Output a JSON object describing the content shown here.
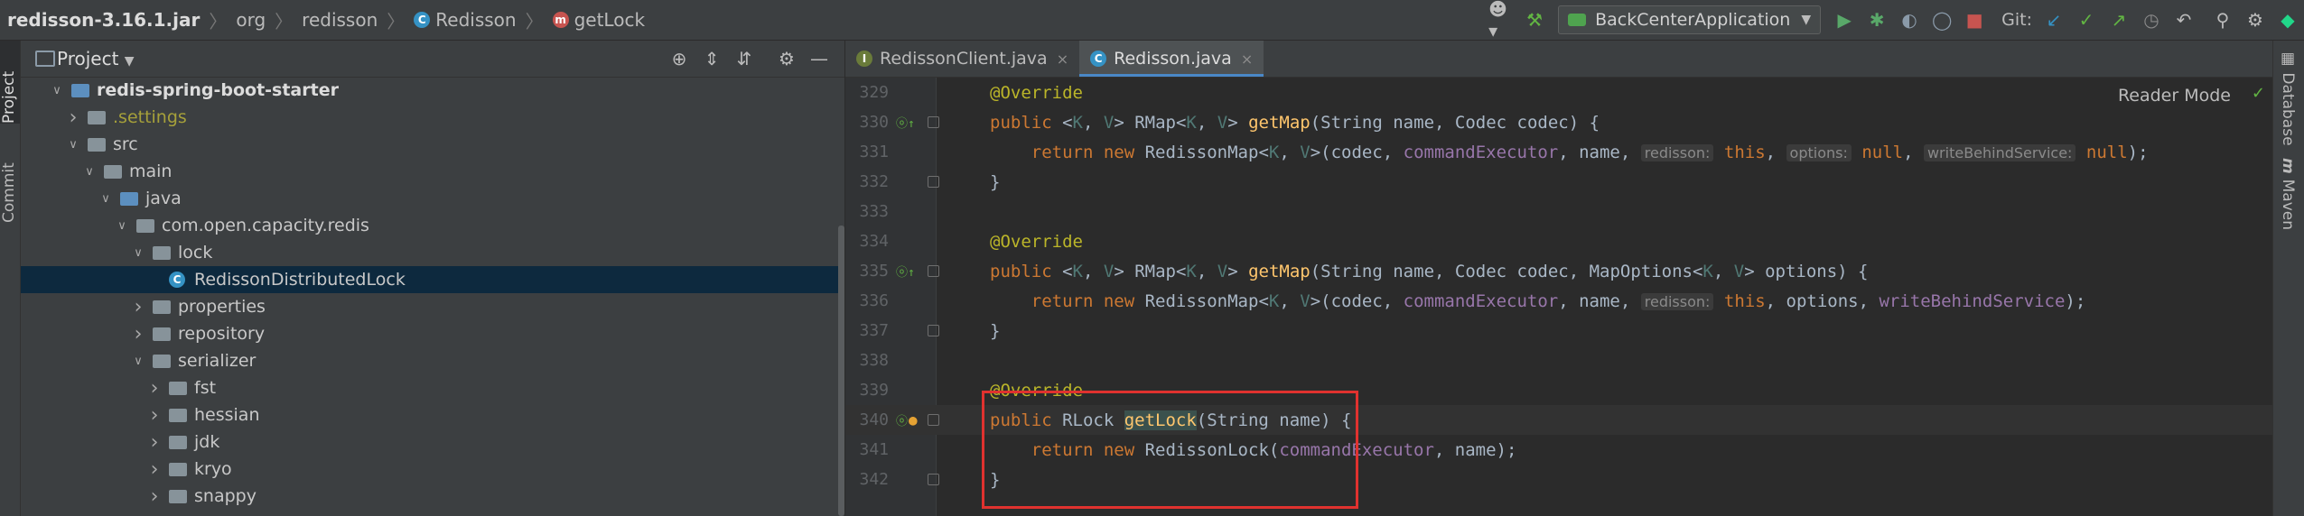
{
  "breadcrumb": {
    "items": [
      {
        "label": "redisson-3.16.1.jar",
        "bold": true
      },
      {
        "label": "org"
      },
      {
        "label": "redisson"
      },
      {
        "label": "Redisson",
        "icon": "class-icon"
      },
      {
        "label": "getLock",
        "icon": "method-icon"
      }
    ]
  },
  "toolbar": {
    "run_config": "BackCenterApplication",
    "git_label": "Git:"
  },
  "left_strip": {
    "project": "Project",
    "commit": "Commit"
  },
  "right_strip": {
    "database": "Database",
    "maven": "Maven"
  },
  "project_panel": {
    "title": "Project",
    "tree": [
      {
        "label": "redis-spring-boot-starter",
        "depth": 2,
        "arrow": "down",
        "icon": "module-folder",
        "bold": true
      },
      {
        "label": ".settings",
        "depth": 3,
        "arrow": "right",
        "icon": "folder",
        "muted": true
      },
      {
        "label": "src",
        "depth": 3,
        "arrow": "down",
        "icon": "folder"
      },
      {
        "label": "main",
        "depth": 4,
        "arrow": "down",
        "icon": "folder"
      },
      {
        "label": "java",
        "depth": 5,
        "arrow": "down",
        "icon": "source-folder"
      },
      {
        "label": "com.open.capacity.redis",
        "depth": 6,
        "arrow": "down",
        "icon": "package"
      },
      {
        "label": "lock",
        "depth": 7,
        "arrow": "down",
        "icon": "package"
      },
      {
        "label": "RedissonDistributedLock",
        "depth": 8,
        "arrow": "",
        "icon": "class",
        "selected": true
      },
      {
        "label": "properties",
        "depth": 7,
        "arrow": "right",
        "icon": "package"
      },
      {
        "label": "repository",
        "depth": 7,
        "arrow": "right",
        "icon": "package"
      },
      {
        "label": "serializer",
        "depth": 7,
        "arrow": "down",
        "icon": "package"
      },
      {
        "label": "fst",
        "depth": 8,
        "arrow": "right",
        "icon": "package"
      },
      {
        "label": "hessian",
        "depth": 8,
        "arrow": "right",
        "icon": "package"
      },
      {
        "label": "jdk",
        "depth": 8,
        "arrow": "right",
        "icon": "package"
      },
      {
        "label": "kryo",
        "depth": 8,
        "arrow": "right",
        "icon": "package"
      },
      {
        "label": "snappy",
        "depth": 8,
        "arrow": "right",
        "icon": "package"
      }
    ]
  },
  "editor": {
    "tabs": [
      {
        "label": "RedissonClient.java",
        "active": false,
        "close": "×"
      },
      {
        "label": "Redisson.java",
        "active": true,
        "close": "×"
      }
    ],
    "reader_mode": "Reader Mode",
    "lines": [
      {
        "num": "329",
        "parts": [
          [
            "an",
            "@Override"
          ]
        ]
      },
      {
        "num": "330",
        "marker": true,
        "parts": [
          [
            "kw",
            "public "
          ],
          [
            "",
            "<"
          ],
          [
            "gn",
            "K"
          ],
          [
            "",
            ", "
          ],
          [
            "gn",
            "V"
          ],
          [
            "",
            "> RMap<"
          ],
          [
            "gn",
            "K"
          ],
          [
            "",
            ", "
          ],
          [
            "gn",
            "V"
          ],
          [
            "",
            "> "
          ],
          [
            "mt",
            "getMap"
          ],
          [
            "",
            "(String name, Codec codec) {"
          ]
        ]
      },
      {
        "num": "331",
        "parts": [
          [
            "",
            "    "
          ],
          [
            "kw",
            "return new "
          ],
          [
            "",
            "RedissonMap<"
          ],
          [
            "gn",
            "K"
          ],
          [
            "",
            ", "
          ],
          [
            "gn",
            "V"
          ],
          [
            "",
            ">(codec, "
          ],
          [
            "fd",
            "commandExecutor"
          ],
          [
            "",
            ", name, "
          ],
          [
            "hint",
            "redisson:"
          ],
          [
            "",
            " "
          ],
          [
            "kw",
            "this"
          ],
          [
            "",
            ", "
          ],
          [
            "hint",
            "options:"
          ],
          [
            "",
            " "
          ],
          [
            "kw",
            "null"
          ],
          [
            "",
            ", "
          ],
          [
            "hint",
            "writeBehindService:"
          ],
          [
            "",
            " "
          ],
          [
            "kw",
            "null"
          ],
          [
            "",
            ");"
          ]
        ]
      },
      {
        "num": "332",
        "parts": [
          [
            "",
            "}"
          ]
        ]
      },
      {
        "num": "333",
        "parts": []
      },
      {
        "num": "334",
        "parts": [
          [
            "an",
            "@Override"
          ]
        ]
      },
      {
        "num": "335",
        "marker": true,
        "parts": [
          [
            "kw",
            "public "
          ],
          [
            "",
            "<"
          ],
          [
            "gn",
            "K"
          ],
          [
            "",
            ", "
          ],
          [
            "gn",
            "V"
          ],
          [
            "",
            "> RMap<"
          ],
          [
            "gn",
            "K"
          ],
          [
            "",
            ", "
          ],
          [
            "gn",
            "V"
          ],
          [
            "",
            "> "
          ],
          [
            "mt",
            "getMap"
          ],
          [
            "",
            "(String name, Codec codec, MapOptions<"
          ],
          [
            "gn",
            "K"
          ],
          [
            "",
            ", "
          ],
          [
            "gn",
            "V"
          ],
          [
            "",
            "> options) {"
          ]
        ]
      },
      {
        "num": "336",
        "parts": [
          [
            "",
            "    "
          ],
          [
            "kw",
            "return new "
          ],
          [
            "",
            "RedissonMap<"
          ],
          [
            "gn",
            "K"
          ],
          [
            "",
            ", "
          ],
          [
            "gn",
            "V"
          ],
          [
            "",
            ">(codec, "
          ],
          [
            "fd",
            "commandExecutor"
          ],
          [
            "",
            ", name, "
          ],
          [
            "hint",
            "redisson:"
          ],
          [
            "",
            " "
          ],
          [
            "kw",
            "this"
          ],
          [
            "",
            ", options, "
          ],
          [
            "fd",
            "writeBehindService"
          ],
          [
            "",
            ");"
          ]
        ]
      },
      {
        "num": "337",
        "parts": [
          [
            "",
            "}"
          ]
        ]
      },
      {
        "num": "338",
        "parts": []
      },
      {
        "num": "339",
        "parts": [
          [
            "an",
            "@Override"
          ]
        ]
      },
      {
        "num": "340",
        "marker": true,
        "current": true,
        "parts": [
          [
            "kw",
            "public "
          ],
          [
            "",
            "RLock "
          ],
          [
            "mt hl",
            "getLock"
          ],
          [
            "",
            "(String name) {"
          ]
        ]
      },
      {
        "num": "341",
        "parts": [
          [
            "",
            "    "
          ],
          [
            "kw",
            "return new "
          ],
          [
            "",
            "RedissonLock("
          ],
          [
            "fd",
            "commandExecutor"
          ],
          [
            "",
            ", name);"
          ]
        ]
      },
      {
        "num": "342",
        "parts": [
          [
            "",
            "}"
          ]
        ]
      }
    ]
  }
}
